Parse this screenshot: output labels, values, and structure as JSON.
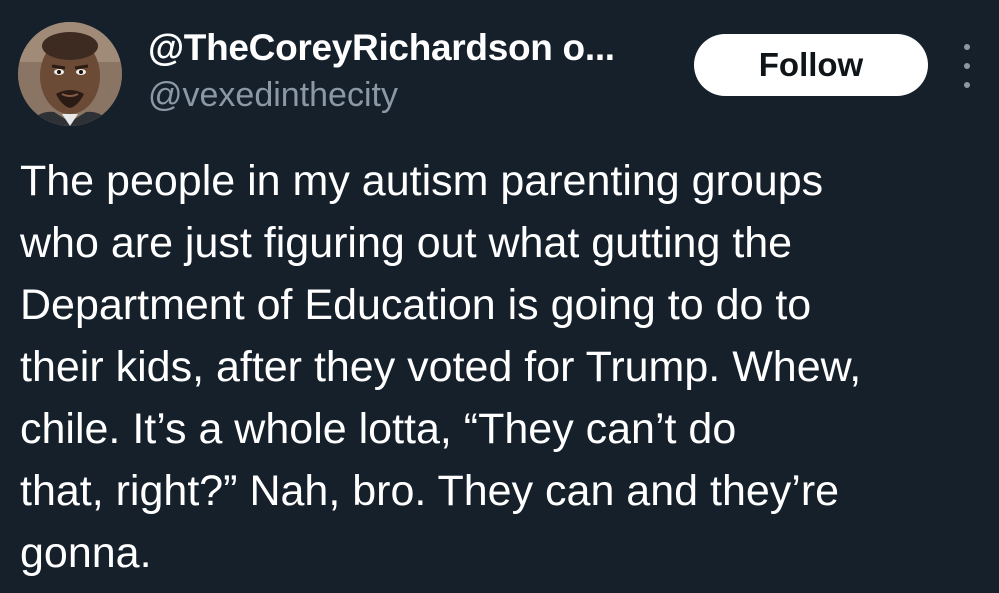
{
  "author": {
    "display_name": "@TheCoreyRichardson o...",
    "handle": "@vexedinthecity",
    "avatar_icon": "user-avatar-photo"
  },
  "actions": {
    "follow_label": "Follow",
    "more_icon": "more-vertical-icon"
  },
  "tweet": {
    "lines": [
      "The people in my autism parenting groups",
      "who are just figuring out what gutting the",
      "Department of Education is going to do to",
      "their kids, after they voted for Trump. Whew,",
      "chile. It’s a whole lotta, “They can’t do",
      "that, right?” Nah, bro. They can and they’re",
      "gonna."
    ]
  },
  "colors": {
    "background": "#15202b",
    "text": "#ffffff",
    "secondary_text": "#8b98a5",
    "button_bg": "#ffffff",
    "button_text": "#0f1419"
  }
}
